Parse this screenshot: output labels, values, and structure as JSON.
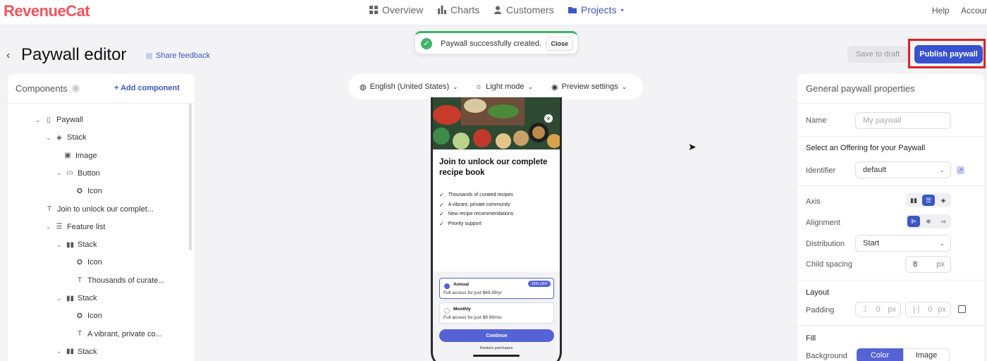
{
  "brand": {
    "logo": "RevenueCat",
    "accent": "#3851d1",
    "logo_color": "#f2545b"
  },
  "nav": {
    "items": [
      {
        "label": "Overview",
        "icon": "grid-icon"
      },
      {
        "label": "Charts",
        "icon": "bar-chart-icon"
      },
      {
        "label": "Customers",
        "icon": "user-icon"
      },
      {
        "label": "Projects",
        "icon": "folder-icon",
        "active": true
      }
    ],
    "help": "Help",
    "account": "Account"
  },
  "toast": {
    "message": "Paywall successfully created.",
    "close": "Close"
  },
  "page": {
    "title": "Paywall editor",
    "feedback": "Share feedback"
  },
  "actions": {
    "save_draft": "Save to draft",
    "publish": "Publish paywall"
  },
  "components": {
    "title": "Components",
    "add": "+ Add component",
    "tree": [
      {
        "label": "Paywall",
        "icon": "phone-icon",
        "depth": 0,
        "expanded": true
      },
      {
        "label": "Stack",
        "icon": "layers-icon",
        "depth": 1,
        "expanded": true
      },
      {
        "label": "Image",
        "icon": "image-icon",
        "depth": 2
      },
      {
        "label": "Button",
        "icon": "button-icon",
        "depth": 2,
        "expanded": true
      },
      {
        "label": "Icon",
        "icon": "icon-icon",
        "depth": 3
      },
      {
        "label": "Join to unlock our complet...",
        "icon": "text-icon",
        "depth": 1
      },
      {
        "label": "Feature list",
        "icon": "list-icon",
        "depth": 1,
        "expanded": true
      },
      {
        "label": "Stack",
        "icon": "columns-icon",
        "depth": 2,
        "expanded": true
      },
      {
        "label": "Icon",
        "icon": "icon-icon",
        "depth": 3
      },
      {
        "label": "Thousands of curate...",
        "icon": "text-icon",
        "depth": 3
      },
      {
        "label": "Stack",
        "icon": "columns-icon",
        "depth": 2,
        "expanded": true
      },
      {
        "label": "Icon",
        "icon": "icon-icon",
        "depth": 3
      },
      {
        "label": "A vibrant, private co...",
        "icon": "text-icon",
        "depth": 3
      },
      {
        "label": "Stack",
        "icon": "columns-icon",
        "depth": 2,
        "expanded": true
      }
    ]
  },
  "preview": {
    "language": "English (United States)",
    "mode": "Light mode",
    "settings": "Preview settings"
  },
  "phone": {
    "headline": "Join to unlock our complete recipe book",
    "features": [
      "Thousands of curated recipes",
      "A vibrant, private community",
      "New recipe recommendations",
      "Priority support"
    ],
    "packages": [
      {
        "name": "Annual",
        "desc": "Full access for just $69.99/yr",
        "badge": "19% OFF",
        "selected": true
      },
      {
        "name": "Monthly",
        "desc": "Full access for just $9.99/mo",
        "badge": "",
        "selected": false
      }
    ],
    "cta": "Continue",
    "restore": "Restore purchases"
  },
  "properties": {
    "title": "General paywall properties",
    "name_label": "Name",
    "name_placeholder": "My paywall",
    "offering_section": "Select an Offering for your Paywall",
    "identifier_label": "Identifier",
    "identifier_value": "default",
    "axis_label": "Axis",
    "alignment_label": "Alignment",
    "distribution_label": "Distribution",
    "distribution_value": "Start",
    "spacing_label": "Child spacing",
    "spacing_value": "8",
    "spacing_unit": "px",
    "layout_section": "Layout",
    "padding_label": "Padding",
    "padding_v": "0",
    "padding_h": "0",
    "padding_unit": "px",
    "fill_section": "Fill",
    "background_label": "Background",
    "background_options": [
      "Color",
      "Image"
    ]
  }
}
